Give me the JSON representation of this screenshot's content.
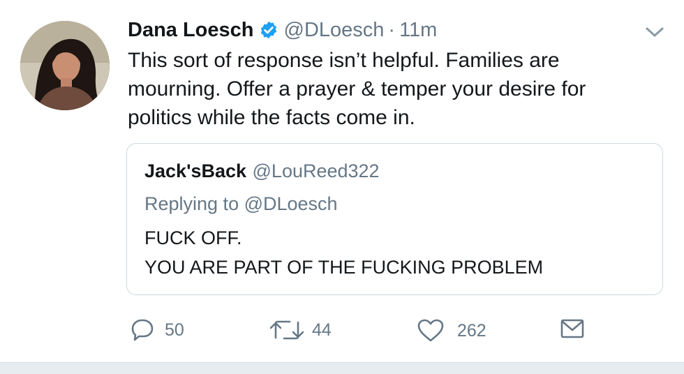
{
  "tweet": {
    "author_name": "Dana Loesch",
    "handle": "@DLoesch",
    "separator": "·",
    "time": "11m",
    "lines": [
      "This sort of response isn’t helpful. Families are",
      "mourning. Offer a prayer & temper your desire for",
      "politics while the facts come in."
    ]
  },
  "quote": {
    "author_name": "Jack'sBack",
    "handle": "@LouReed322",
    "replying_to": "Replying to @DLoesch",
    "lines": [
      "FUCK OFF.",
      "YOU ARE PART OF THE FUCKING PROBLEM"
    ]
  },
  "actions": {
    "reply_count": "50",
    "retweet_count": "44",
    "like_count": "262"
  },
  "icons": {
    "verified": "verified-badge-icon",
    "menu": "chevron-down-icon",
    "reply": "reply-bubble-icon",
    "retweet": "retweet-icon",
    "like": "heart-icon",
    "dm": "envelope-icon"
  },
  "colors": {
    "verified_blue": "#1da1f2",
    "secondary_text": "#657786",
    "primary_text": "#14171a",
    "quote_border": "#cfd9de"
  }
}
